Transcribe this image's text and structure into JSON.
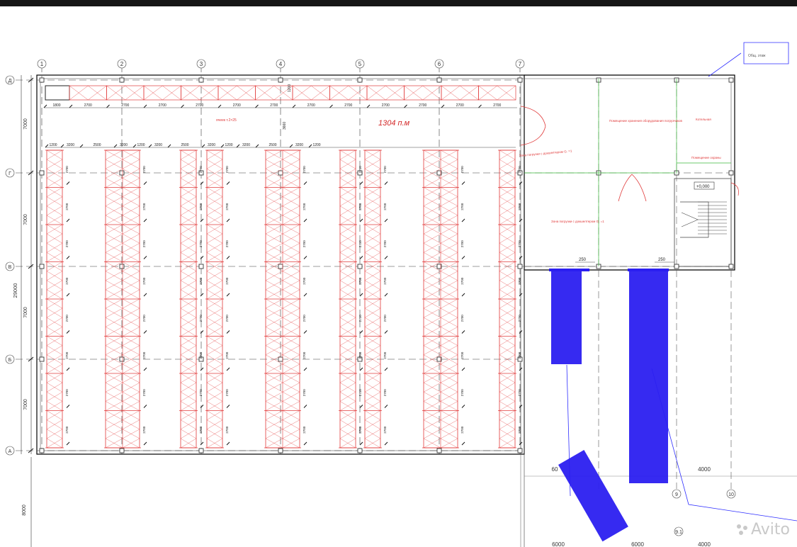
{
  "colors": {
    "frame": "#000000",
    "grid": "#3c3c3c",
    "rack": "#e23b3b",
    "room": "#e03a3a",
    "zone": "#3cba3c",
    "trailer": "#2b1ff0",
    "site": "#2d2dff"
  },
  "axes": {
    "columns": [
      "1",
      "2",
      "3",
      "4",
      "5",
      "6",
      "7"
    ],
    "rows": [
      "Д",
      "Г",
      "В",
      "Б",
      "А"
    ],
    "ext_columns": [
      "9",
      "10",
      "9.1"
    ]
  },
  "dims": {
    "left_spans": [
      "7000",
      "7000",
      "7000",
      "7000"
    ],
    "left_total": "29000",
    "below": "8000",
    "top_row": [
      "1800",
      "2700",
      "2700",
      "2700",
      "2700",
      "2700",
      "2700",
      "2700",
      "2700",
      "2700",
      "2700",
      "2700",
      "2700"
    ],
    "rack_row": [
      "1200",
      "3200",
      "2500",
      "3200",
      "1200",
      "3200",
      "2500",
      "3200",
      "1200",
      "3200",
      "2500",
      "3200",
      "1200"
    ],
    "rack_vertical": "2700",
    "aisle": "1200",
    "vertical_gap": "3660",
    "dock_gaps": [
      "250",
      "250"
    ],
    "right_bottom": [
      "4000",
      "6000",
      "6000",
      "4000"
    ],
    "trailer_dim": "60"
  },
  "labels": {
    "total_length": "1304 п.м",
    "tag_top": "Общ. этаж",
    "elev": "+0,000",
    "small_a": "ячеек т.2×25",
    "room_a": "Зона погрузки с докшелтером G. =1",
    "room_b": "Помещение хранения оборудования погрузчиков",
    "room_c": "Котельная",
    "room_d": "Помещение охраны",
    "room_e": "Зона погрузки с докшелтером G. =1"
  },
  "watermark": "Avito"
}
